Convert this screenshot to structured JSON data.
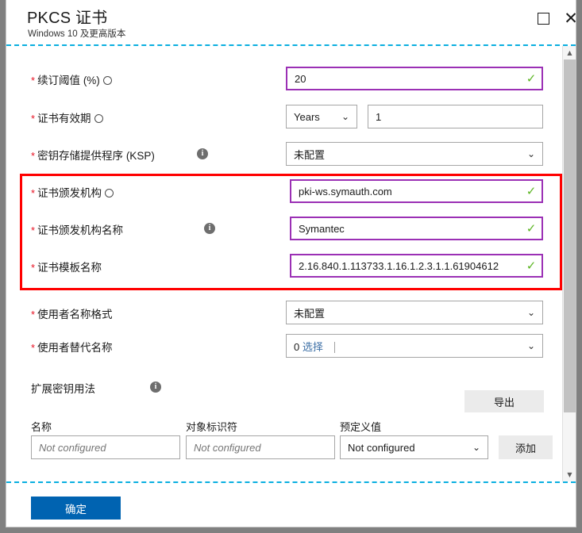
{
  "window": {
    "title": "PKCS 证书",
    "subtitle": "Windows 10 及更高版本",
    "maximize_icon": "maximize-icon",
    "close_icon": "close-icon"
  },
  "fields": [
    {
      "label": "续订阈值 (%)",
      "required": true,
      "icon": "circle-info-outline-icon",
      "value": "20",
      "validated": true,
      "check": "✓"
    },
    {
      "label": "证书有效期",
      "required": true,
      "icon": "circle-info-outline-icon",
      "unit": "Years",
      "value": "1",
      "caret": "⌄"
    },
    {
      "label": "密钥存储提供程序 (KSP)",
      "required": true,
      "icon": "info-icon",
      "value": "未配置",
      "caret": "⌄"
    },
    {
      "label": "证书颁发机构",
      "required": true,
      "icon": "circle-info-outline-icon",
      "value": "pki-ws.symauth.com",
      "validated": true,
      "check": "✓"
    },
    {
      "label": "证书颁发机构名称",
      "required": true,
      "icon": "info-icon",
      "value": "Symantec",
      "validated": true,
      "check": "✓"
    },
    {
      "label": "证书模板名称",
      "required": true,
      "value": "2.16.840.1.113733.1.16.1.2.3.1.1.61904612",
      "validated": true,
      "check": "✓"
    },
    {
      "label": "使用者名称格式",
      "required": true,
      "value": "未配置",
      "caret": "⌄"
    },
    {
      "label": "使用者替代名称",
      "required": true,
      "count": "0",
      "select_label": "选择",
      "caret": "⌄"
    },
    {
      "label": "扩展密钥用法",
      "required": false,
      "icon": "info-icon"
    }
  ],
  "eku_table": {
    "export_button": "导出",
    "add_button": "添加",
    "headers": [
      "名称",
      "对象标识符",
      "预定义值"
    ],
    "row": {
      "name_placeholder": "Not configured",
      "oid_placeholder": "Not configured",
      "predefined_value": "Not configured",
      "caret": "⌄"
    }
  },
  "footer": {
    "ok_button": "确定"
  },
  "scrollbar": {
    "up_arrow": "▲",
    "down_arrow": "▼"
  },
  "colors": {
    "accent": "#0063b1",
    "validated_border": "#9b30b5",
    "check": "#5bb522",
    "required": "#e81123",
    "highlight": "#ff0000",
    "dash_separator": "#0aafe0"
  }
}
